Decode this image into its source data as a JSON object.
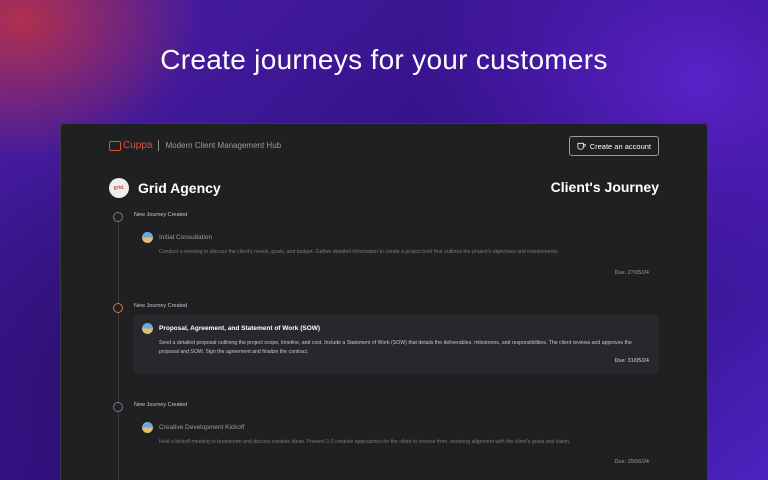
{
  "headline": "Create journeys for your customers",
  "brand": {
    "name": "Cuppa",
    "tagline": "Modern Client Management Hub",
    "accent": "#e0503a"
  },
  "header": {
    "create_account_label": "Create an account",
    "agency_initials": "grid.",
    "agency_name": "Grid Agency",
    "journey_title": "Client's Journey"
  },
  "steps": [
    {
      "label": "New Journey Created",
      "title": "Initial Consultation",
      "description": "Conduct a meeting to discuss the client's needs, goals, and budget. Gather detailed information to create a project brief that outlines the project's objectives and requirements.",
      "due": "Due: 27/05/24",
      "state": "done"
    },
    {
      "label": "New Journey Created",
      "title": "Proposal, Agreement, and Statement of Work (SOW)",
      "description": "Send a detailed proposal outlining the project scope, timeline, and cost. Include a Statement of Work (SOW) that details the deliverables, milestones, and responsibilities. The client reviews and approves the proposal and SOW. Sign the agreement and finalize the contract.",
      "due": "Due: 31/05/24",
      "state": "active"
    },
    {
      "label": "New Journey Created",
      "title": "Creative Development Kickoff",
      "description": "Hold a kickoff meeting to brainstorm and discuss creative ideas. Present 2-3 creative approaches for the client to choose from, ensuring alignment with the client's goals and vision.",
      "due": "Due: 29/06/24",
      "state": "pending"
    }
  ]
}
